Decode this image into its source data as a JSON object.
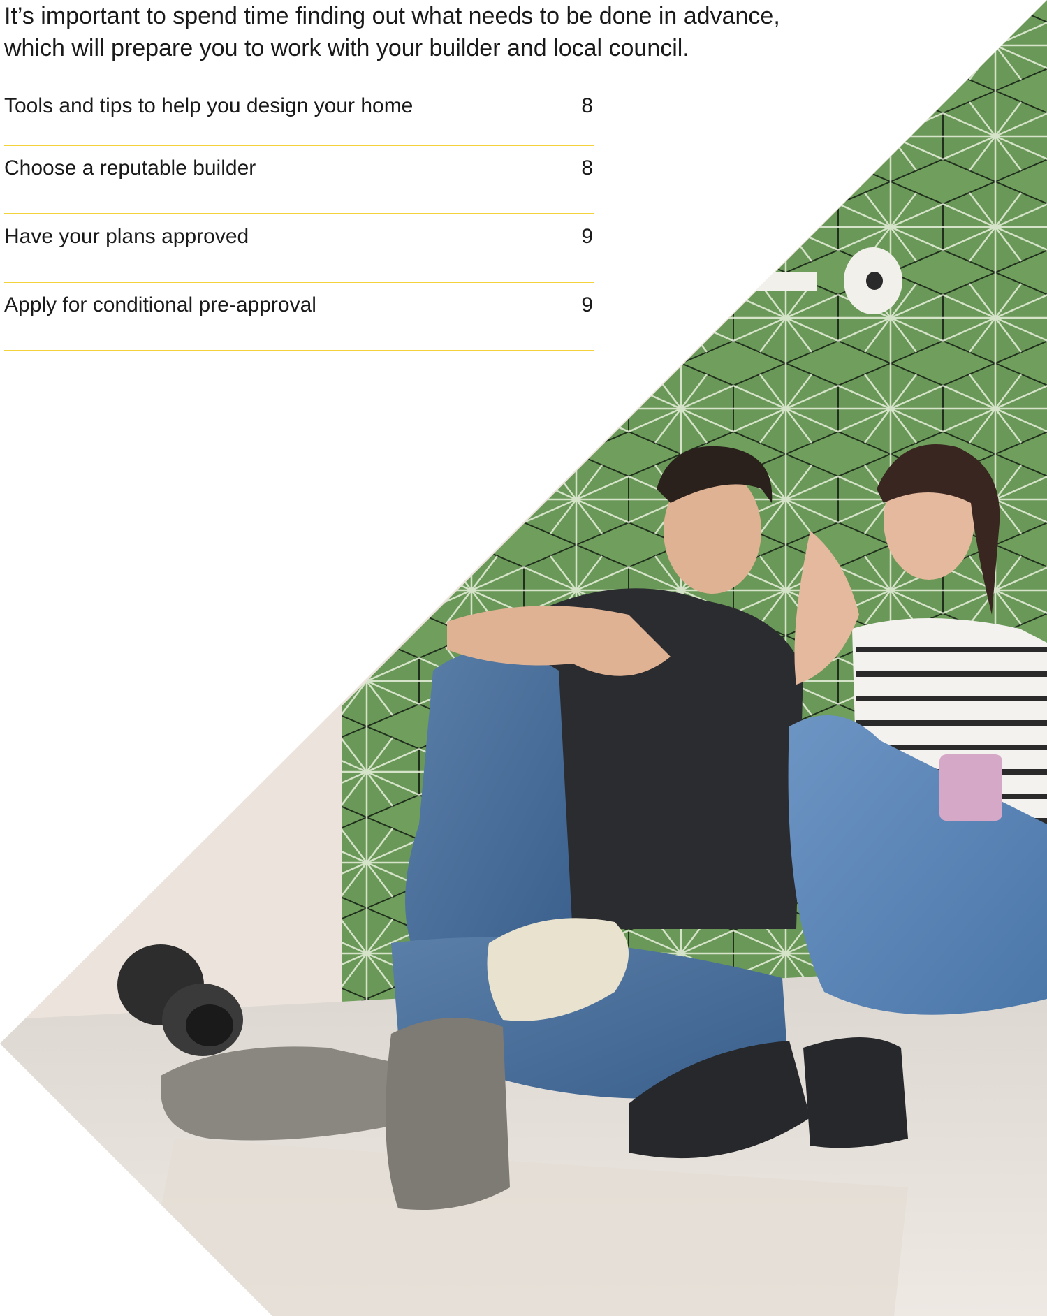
{
  "intro": {
    "line1": "It’s important to spend time finding out what needs to be done in advance,",
    "line2": "which will prepare you to work with your builder and local council."
  },
  "toc": [
    {
      "label": "Tools and tips to help you design your home",
      "page": "8"
    },
    {
      "label": "Choose a reputable builder",
      "page": "8"
    },
    {
      "label": "Have your plans approved",
      "page": "9"
    },
    {
      "label": "Apply for conditional pre-approval",
      "page": "9"
    }
  ],
  "colors": {
    "divider": "#f2d43a",
    "tile_green": "#6e9e5c",
    "text": "#1a1a1a"
  }
}
